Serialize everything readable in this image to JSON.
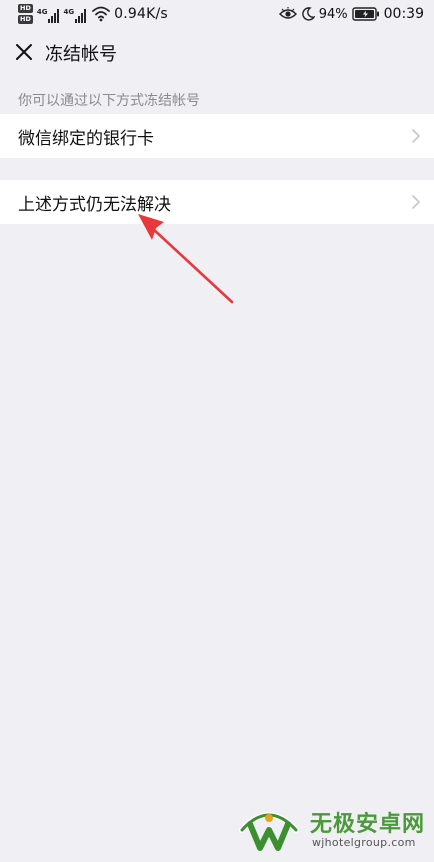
{
  "status_bar": {
    "hd_badge_1": "HD",
    "hd_badge_2": "HD",
    "sig1_tag": "4G",
    "sig2_tag": "4G",
    "net_speed": "0.94K/s",
    "battery_percent": "94%",
    "time": "00:39",
    "icons": [
      "hd-icon",
      "signal-icon",
      "wifi-icon",
      "eye-comfort-icon",
      "moon-icon",
      "battery-icon"
    ]
  },
  "header": {
    "title": "冻结帐号",
    "close_icon": "close-icon"
  },
  "section": {
    "hint": "你可以通过以下方式冻结帐号"
  },
  "items": [
    {
      "label": "微信绑定的银行卡",
      "icon": "chevron-right-icon"
    },
    {
      "label": "上述方式仍无法解决",
      "icon": "chevron-right-icon"
    }
  ],
  "watermark": {
    "name": "无极安卓网",
    "url": "wjhotelgroup.com"
  },
  "colors": {
    "background": "#efeff4",
    "card": "#ffffff",
    "hint_text": "#8a8a8f",
    "annotation": "#e8383b",
    "watermark_green": "#4a9a3a"
  }
}
